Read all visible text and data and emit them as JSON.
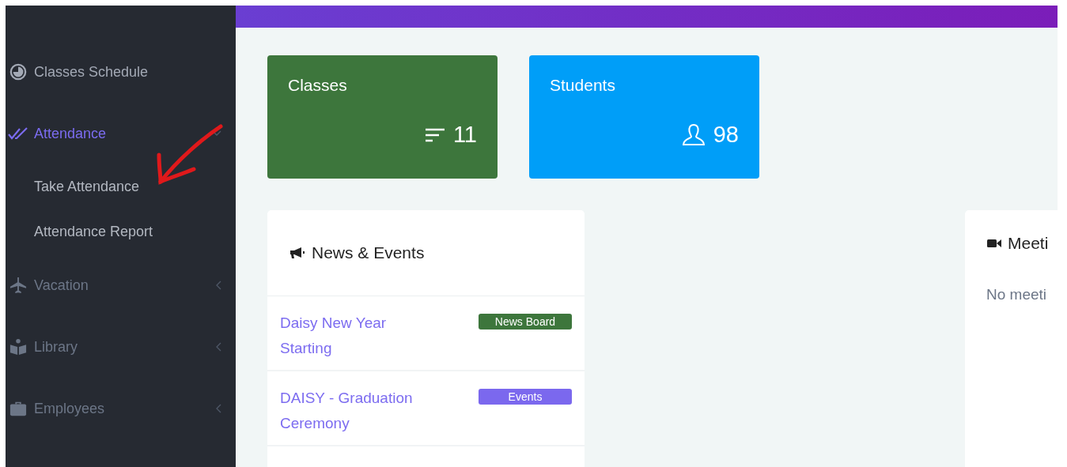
{
  "sidebar": {
    "items": [
      {
        "kind": "link",
        "label": "Classes Schedule",
        "selected": false
      },
      {
        "kind": "menu",
        "label": "Attendance",
        "selected": true,
        "expanded": true,
        "children": [
          {
            "label": "Take Attendance"
          },
          {
            "label": "Attendance Report"
          }
        ]
      },
      {
        "kind": "menu",
        "label": "Vacation",
        "selected": false,
        "expanded": false
      },
      {
        "kind": "menu",
        "label": "Library",
        "selected": false,
        "expanded": false
      },
      {
        "kind": "menu",
        "label": "Employees",
        "selected": false,
        "expanded": false
      }
    ]
  },
  "stat_cards": [
    {
      "title": "Classes",
      "value": "11",
      "color": "#3d763c"
    },
    {
      "title": "Students",
      "value": "98",
      "color": "#009ef8"
    }
  ],
  "news_panel": {
    "title": "News & Events",
    "items": [
      {
        "title": "Daisy New Year Starting",
        "tag": "News Board",
        "color": "#3d763c"
      },
      {
        "title": "DAISY - Graduation Ceremony",
        "tag": "Events",
        "color": "#7b68ee"
      }
    ]
  },
  "meetings_panel": {
    "title": "Meeti",
    "message": "No meeti"
  }
}
